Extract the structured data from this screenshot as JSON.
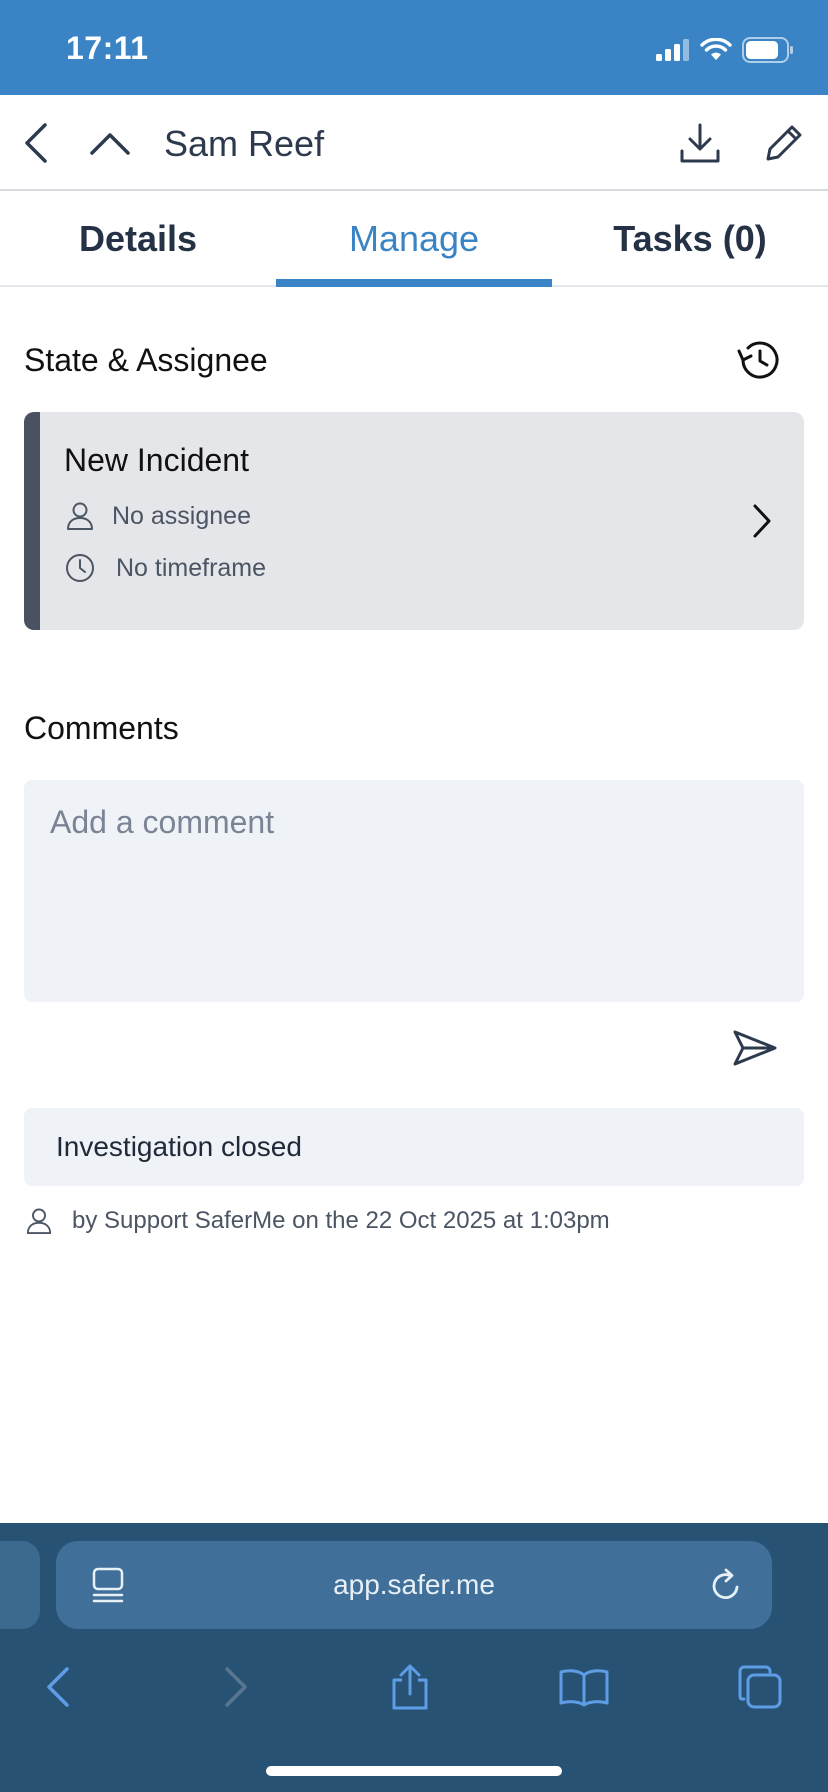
{
  "status_bar": {
    "time": "17:11"
  },
  "header": {
    "title": "Sam Reef"
  },
  "tabs": [
    {
      "label": "Details"
    },
    {
      "label": "Manage"
    },
    {
      "label": "Tasks (0)"
    }
  ],
  "manage": {
    "state_section_title": "State & Assignee",
    "state_card": {
      "state": "New Incident",
      "assignee": "No assignee",
      "timeframe": "No timeframe",
      "accent_color": "#4a5262"
    },
    "comments_title": "Comments",
    "comment_input": {
      "placeholder": "Add a comment",
      "value": ""
    },
    "activity": [
      {
        "text": "Investigation closed",
        "meta": "by Support SaferMe on the 22 Oct 2025 at 1:03pm"
      }
    ]
  },
  "browser": {
    "url": "app.safer.me"
  },
  "colors": {
    "brand": "#3a84c5",
    "browser_bar": "#285274"
  }
}
